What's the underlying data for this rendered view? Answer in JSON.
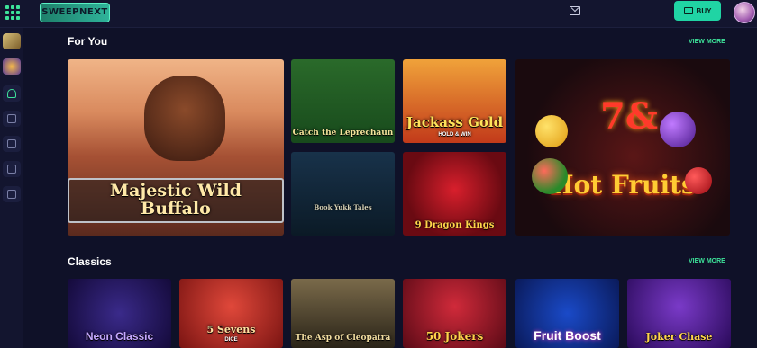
{
  "header": {
    "logo_text": "SWEEPNEXT",
    "buy_label": "BUY"
  },
  "sections": {
    "for_you": {
      "title": "For You",
      "view_more": "VIEW MORE",
      "games": [
        {
          "title": "Majestic Wild Buffalo"
        },
        {
          "title": "Catch the Leprechaun"
        },
        {
          "title": "Jackass Gold",
          "subtitle": "HOLD & WIN"
        },
        {
          "title": "Book Yukk Tales"
        },
        {
          "title": "9 Dragon Kings"
        },
        {
          "title": "Hot Fruits",
          "badge": "7&"
        }
      ]
    },
    "classics": {
      "title": "Classics",
      "view_more": "VIEW MORE",
      "games": [
        {
          "title": "Neon Classic"
        },
        {
          "title": "5 Sevens",
          "subtitle": "DICE"
        },
        {
          "title": "The Asp of Cleopatra"
        },
        {
          "title": "50 Jokers"
        },
        {
          "title": "Fruit Boost"
        },
        {
          "title": "Joker Chase"
        }
      ]
    }
  },
  "colors": {
    "accent": "#20d4a4",
    "background": "#0f1128",
    "panel": "#13152f"
  }
}
